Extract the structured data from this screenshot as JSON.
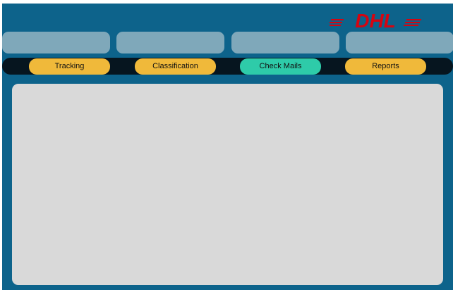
{
  "brand": {
    "logo_text": "DHL",
    "logo_color": "#d40511"
  },
  "colors": {
    "background": "#0d638b",
    "tile": "#7fa8ba",
    "navbar": "#06151f",
    "button": "#f0b93a",
    "button_active": "#2ecba9",
    "panel": "#d9d9d9"
  },
  "nav": {
    "items": [
      {
        "label": "Tracking",
        "active": false
      },
      {
        "label": "Classification",
        "active": false
      },
      {
        "label": "Check Mails",
        "active": true
      },
      {
        "label": "Reports",
        "active": false
      }
    ]
  }
}
